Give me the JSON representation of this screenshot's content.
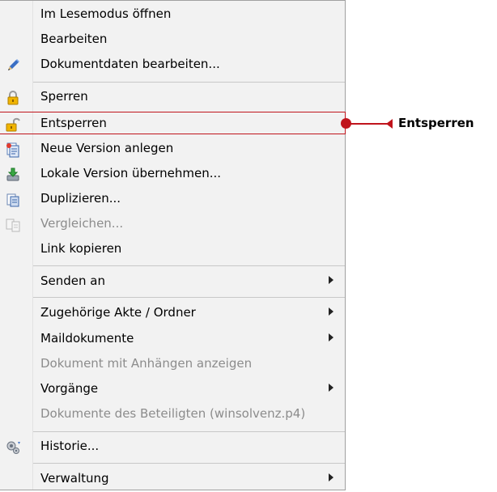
{
  "menu": {
    "items": [
      {
        "label": "Im Lesemodus öffnen",
        "icon": "none",
        "enabled": true,
        "submenu": false
      },
      {
        "label": "Bearbeiten",
        "icon": "none",
        "enabled": true,
        "submenu": false
      },
      {
        "label": "Dokumentdaten bearbeiten...",
        "icon": "pencil-icon",
        "enabled": true,
        "submenu": false
      },
      {
        "label": "Sperren",
        "icon": "lock-icon",
        "enabled": true,
        "submenu": false
      },
      {
        "label": "Entsperren",
        "icon": "unlock-icon",
        "enabled": true,
        "submenu": false
      },
      {
        "label": "Neue Version anlegen",
        "icon": "new-version-icon",
        "enabled": true,
        "submenu": false
      },
      {
        "label": "Lokale Version übernehmen...",
        "icon": "import-icon",
        "enabled": true,
        "submenu": false
      },
      {
        "label": "Duplizieren...",
        "icon": "duplicate-icon",
        "enabled": true,
        "submenu": false
      },
      {
        "label": "Vergleichen...",
        "icon": "compare-icon",
        "enabled": false,
        "submenu": false
      },
      {
        "label": "Link kopieren",
        "icon": "none",
        "enabled": true,
        "submenu": false
      },
      {
        "label": "Senden an",
        "icon": "none",
        "enabled": true,
        "submenu": true
      },
      {
        "label": "Zugehörige Akte / Ordner",
        "icon": "none",
        "enabled": true,
        "submenu": true
      },
      {
        "label": "Maildokumente",
        "icon": "none",
        "enabled": true,
        "submenu": true
      },
      {
        "label": "Dokument mit Anhängen anzeigen",
        "icon": "none",
        "enabled": false,
        "submenu": false
      },
      {
        "label": "Vorgänge",
        "icon": "none",
        "enabled": true,
        "submenu": true
      },
      {
        "label": "Dokumente des Beteiligten (winsolvenz.p4)",
        "icon": "none",
        "enabled": false,
        "submenu": false
      },
      {
        "label": "Historie...",
        "icon": "history-icon",
        "enabled": true,
        "submenu": false
      },
      {
        "label": "Verwaltung",
        "icon": "none",
        "enabled": true,
        "submenu": true
      }
    ]
  },
  "callout": {
    "label": "Entsperren",
    "color": "#c0141c"
  }
}
